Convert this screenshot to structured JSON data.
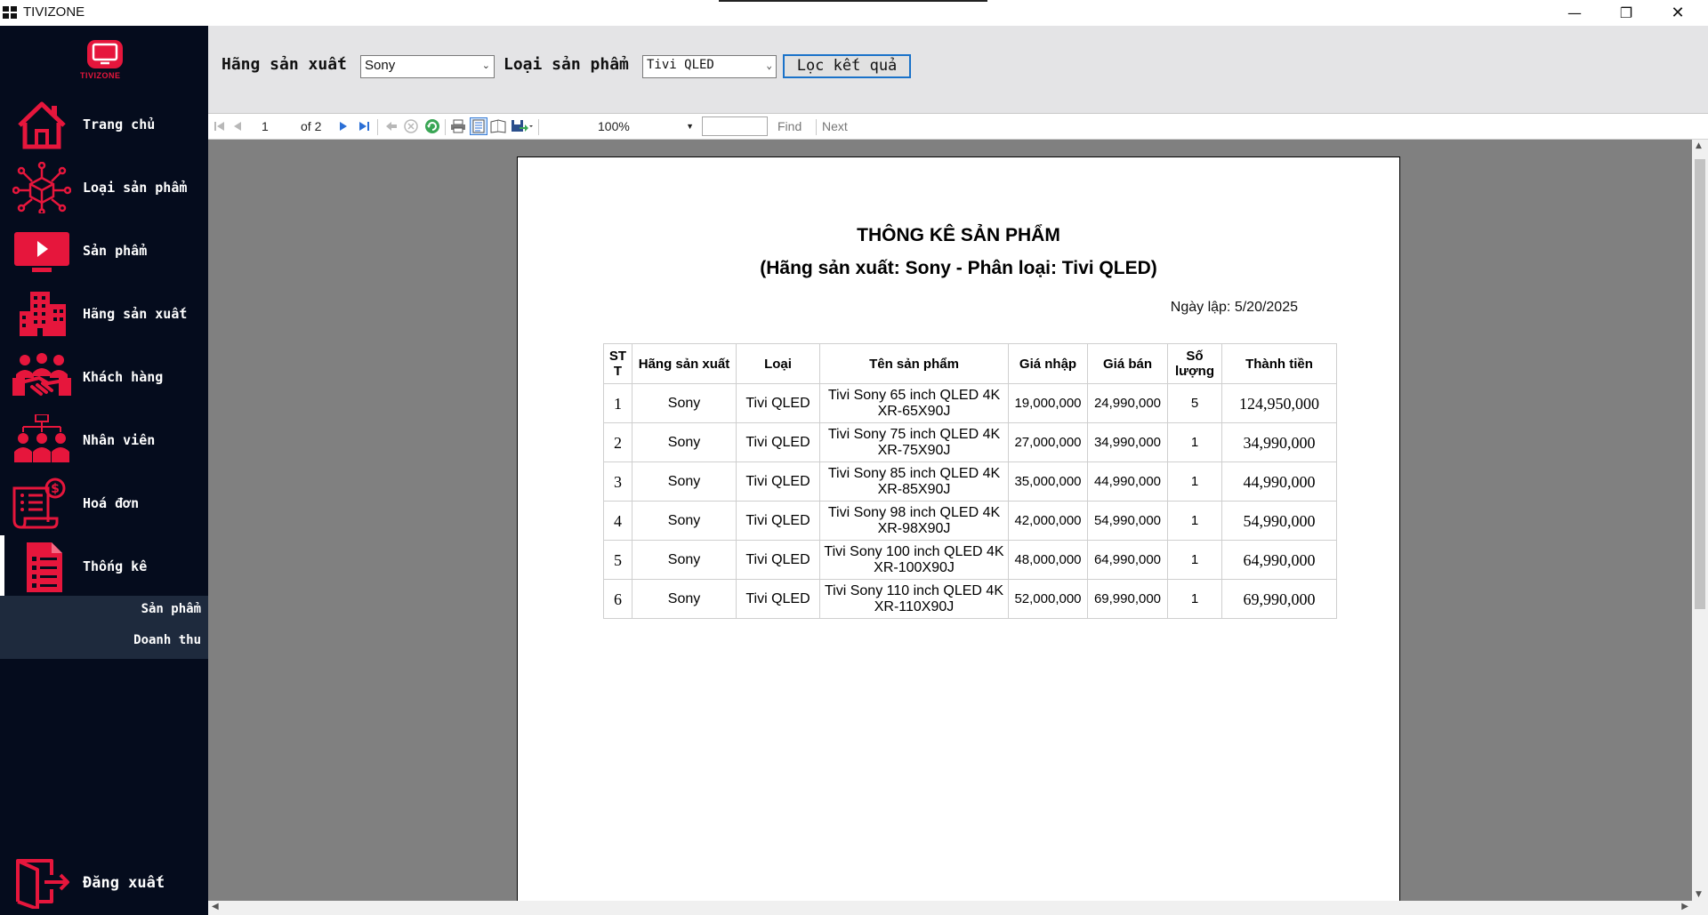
{
  "window": {
    "title": "TIVIZONE",
    "minimize": "—",
    "maximize": "❐",
    "close": "✕"
  },
  "sidebar": {
    "logo_text": "TIVIZONE",
    "items": [
      {
        "label": "Trang chủ",
        "icon": "home-icon"
      },
      {
        "label": "Loại sản phẩm",
        "icon": "category-network-icon"
      },
      {
        "label": "Sản phẩm",
        "icon": "tv-play-icon"
      },
      {
        "label": "Hãng sản xuất",
        "icon": "building-icon"
      },
      {
        "label": "Khách hàng",
        "icon": "handshake-icon"
      },
      {
        "label": "Nhân viên",
        "icon": "employees-icon"
      },
      {
        "label": "Hoá đơn",
        "icon": "invoice-icon"
      },
      {
        "label": "Thống kê",
        "icon": "report-list-icon"
      }
    ],
    "sub_items": [
      {
        "label": "Sản phẩm"
      },
      {
        "label": "Doanh thu"
      }
    ],
    "logout": {
      "label": "Đăng xuất",
      "icon": "logout-icon"
    }
  },
  "filters": {
    "manufacturer_label": "Hãng sản xuất",
    "manufacturer_value": "Sony",
    "type_label": "Loại sản phẩm",
    "type_value": "Tivi QLED",
    "filter_button": "Lọc kết quả"
  },
  "report_toolbar": {
    "page": "1",
    "of_pages": "of 2",
    "zoom": "100%",
    "find": "Find",
    "next": "Next"
  },
  "report": {
    "title": "THÔNG KÊ SẢN PHẨM",
    "subtitle": "(Hãng sản xuất: Sony - Phân loại: Tivi QLED)",
    "date": "Ngày lập: 5/20/2025",
    "columns": [
      "ST T",
      "Hãng sản xuất",
      "Loại",
      "Tên sản phẩm",
      "Giá nhập",
      "Giá bán",
      "Số lượng",
      "Thành tiền"
    ],
    "rows": [
      {
        "stt": "1",
        "brand": "Sony",
        "type": "Tivi QLED",
        "name": "Tivi Sony 65 inch QLED 4K XR-65X90J",
        "cost": "19,000,000",
        "price": "24,990,000",
        "qty": "5",
        "total": "124,950,000"
      },
      {
        "stt": "2",
        "brand": "Sony",
        "type": "Tivi QLED",
        "name": "Tivi Sony 75 inch QLED 4K XR-75X90J",
        "cost": "27,000,000",
        "price": "34,990,000",
        "qty": "1",
        "total": "34,990,000"
      },
      {
        "stt": "3",
        "brand": "Sony",
        "type": "Tivi QLED",
        "name": "Tivi Sony 85 inch QLED 4K XR-85X90J",
        "cost": "35,000,000",
        "price": "44,990,000",
        "qty": "1",
        "total": "44,990,000"
      },
      {
        "stt": "4",
        "brand": "Sony",
        "type": "Tivi QLED",
        "name": "Tivi Sony 98 inch QLED 4K XR-98X90J",
        "cost": "42,000,000",
        "price": "54,990,000",
        "qty": "1",
        "total": "54,990,000"
      },
      {
        "stt": "5",
        "brand": "Sony",
        "type": "Tivi QLED",
        "name": "Tivi Sony 100 inch QLED 4K XR-100X90J",
        "cost": "48,000,000",
        "price": "64,990,000",
        "qty": "1",
        "total": "64,990,000"
      },
      {
        "stt": "6",
        "brand": "Sony",
        "type": "Tivi QLED",
        "name": "Tivi Sony 110 inch QLED 4K XR-110X90J",
        "cost": "52,000,000",
        "price": "69,990,000",
        "qty": "1",
        "total": "69,990,000"
      }
    ]
  },
  "colors": {
    "accent": "#e6163c",
    "sidebar_bg": "#050c1d",
    "submenu_bg": "#1e2a3d",
    "report_bg": "#808080",
    "filterbar_bg": "#e4e4e6"
  }
}
